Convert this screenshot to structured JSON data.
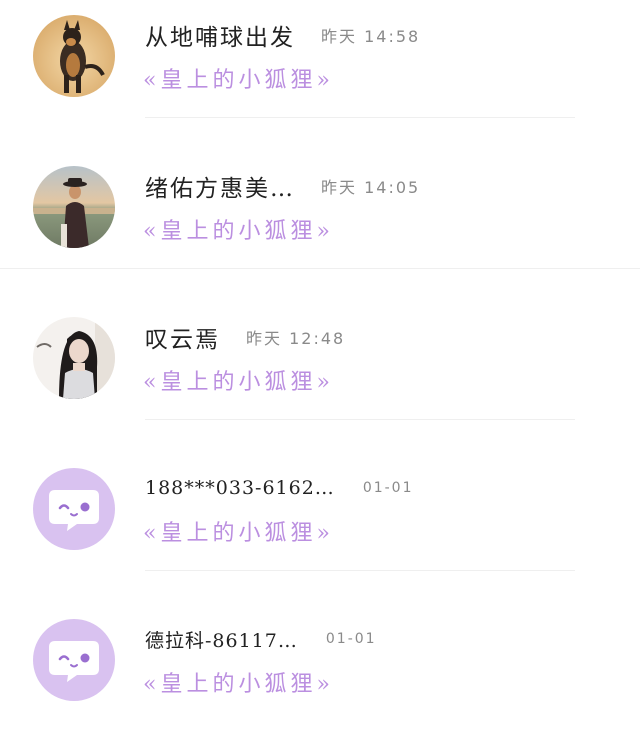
{
  "conversations": [
    {
      "name": "从地哺球出发",
      "time": "昨天 14:58",
      "subtitle": "«皇上的小狐狸»",
      "avatar": "dog-photo-avatar"
    },
    {
      "name": "绪佑方惠美…",
      "time": "昨天 14:05",
      "subtitle": "«皇上的小狐狸»",
      "avatar": "man-with-hat-photo-avatar"
    },
    {
      "name": "叹云焉",
      "time": "昨天 12:48",
      "subtitle": "«皇上的小狐狸»",
      "avatar": "person-portrait-photo-avatar"
    },
    {
      "name": "188***033-6162…",
      "time": "01-01",
      "subtitle": "«皇上的小狐狸»",
      "avatar": "default-chat-bubble-avatar"
    },
    {
      "name": "德拉科-86117…",
      "time": "01-01",
      "subtitle": "«皇上的小狐狸»",
      "avatar": "default-chat-bubble-avatar"
    }
  ],
  "colors": {
    "subtitle": "#bb8fe0",
    "name": "#222222",
    "time": "#8a8a8a",
    "default_avatar_bg": "#d9c2f0",
    "divider": "#efefef"
  }
}
